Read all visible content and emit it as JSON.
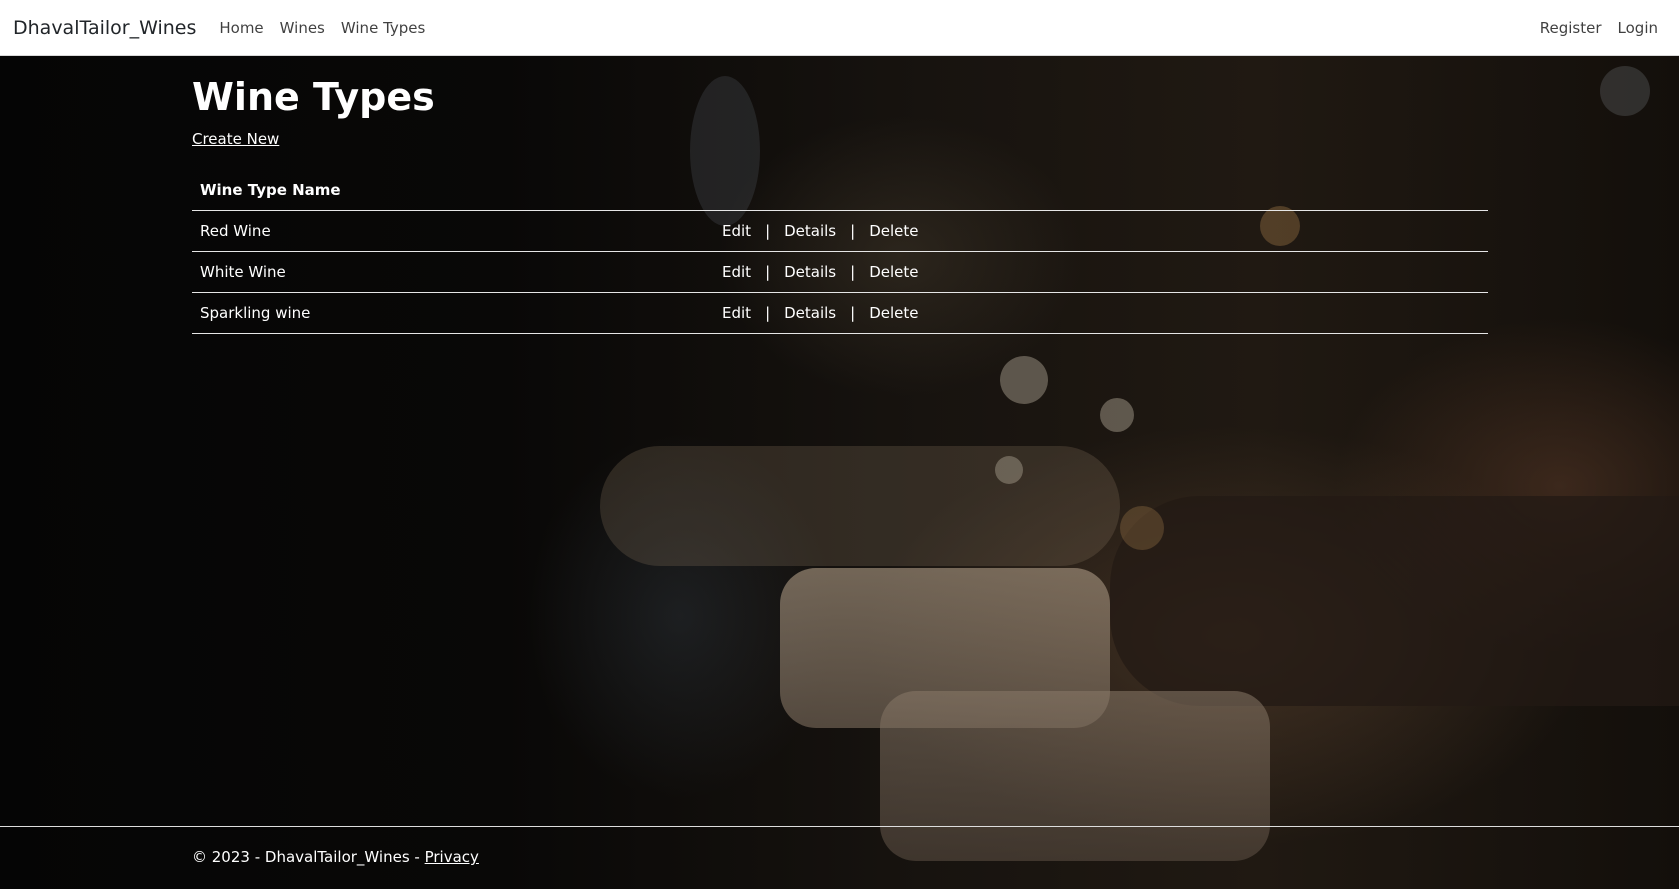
{
  "navbar": {
    "brand": "DhavalTailor_Wines",
    "links": [
      "Home",
      "Wines",
      "Wine Types"
    ],
    "right_links": [
      "Register",
      "Login"
    ]
  },
  "main": {
    "title": "Wine Types",
    "create_new": "Create New",
    "table": {
      "header": "Wine Type Name",
      "rows": [
        {
          "name": "Red Wine",
          "actions": [
            "Edit",
            "Details",
            "Delete"
          ]
        },
        {
          "name": "White Wine",
          "actions": [
            "Edit",
            "Details",
            "Delete"
          ]
        },
        {
          "name": "Sparkling wine",
          "actions": [
            "Edit",
            "Details",
            "Delete"
          ]
        }
      ],
      "separator": "|"
    }
  },
  "footer": {
    "copyright": "© 2023 - DhavalTailor_Wines - ",
    "privacy": "Privacy"
  }
}
